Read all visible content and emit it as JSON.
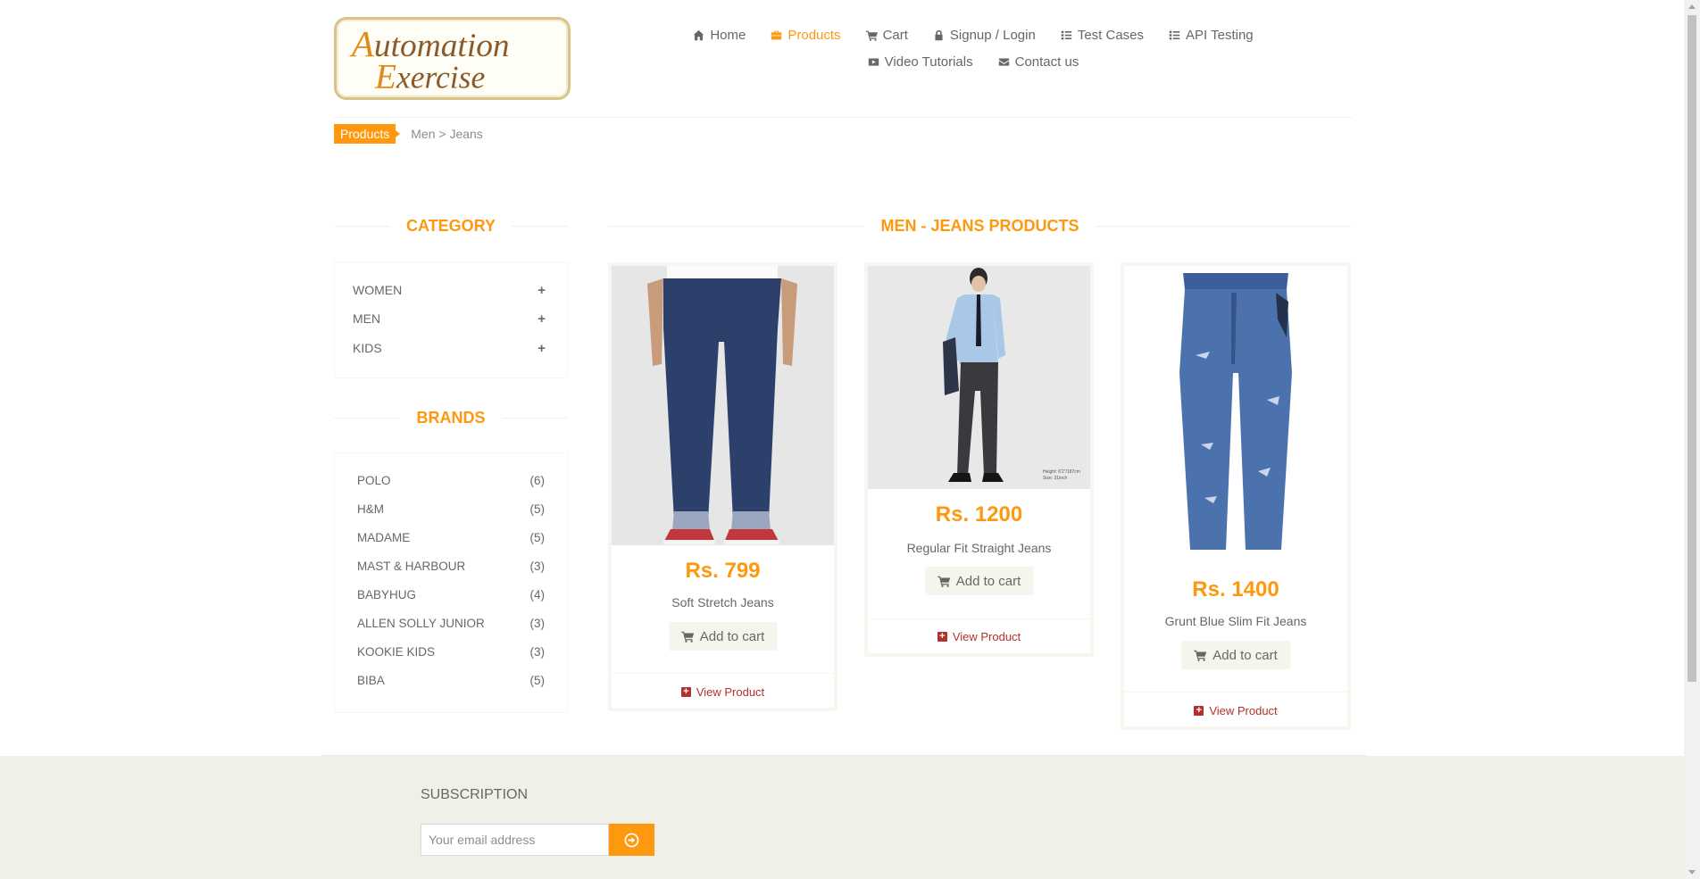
{
  "logo": {
    "line1": "Automation",
    "line2": "Exercise"
  },
  "nav": {
    "row1": [
      {
        "label": "Home",
        "icon": "home-icon"
      },
      {
        "label": "Products",
        "icon": "briefcase-icon",
        "active": true
      },
      {
        "label": "Cart",
        "icon": "cart-icon"
      },
      {
        "label": "Signup / Login",
        "icon": "lock-icon"
      },
      {
        "label": "Test Cases",
        "icon": "list-icon"
      },
      {
        "label": "API Testing",
        "icon": "list-icon"
      }
    ],
    "row2": [
      {
        "label": "Video Tutorials",
        "icon": "youtube-icon"
      },
      {
        "label": "Contact us",
        "icon": "envelope-icon"
      }
    ]
  },
  "breadcrumb": {
    "active": "Products",
    "rest": "Men > Jeans"
  },
  "sidebar": {
    "category_title": "Category",
    "categories": [
      "WOMEN",
      "MEN",
      "KIDS"
    ],
    "brands_title": "Brands",
    "brands": [
      {
        "name": "POLO",
        "count": "(6)"
      },
      {
        "name": "H&M",
        "count": "(5)"
      },
      {
        "name": "MADAME",
        "count": "(5)"
      },
      {
        "name": "MAST & HARBOUR",
        "count": "(3)"
      },
      {
        "name": "BABYHUG",
        "count": "(4)"
      },
      {
        "name": "ALLEN SOLLY JUNIOR",
        "count": "(3)"
      },
      {
        "name": "KOOKIE KIDS",
        "count": "(3)"
      },
      {
        "name": "BIBA",
        "count": "(5)"
      }
    ]
  },
  "main": {
    "title": "Men - Jeans Products",
    "products": [
      {
        "price": "Rs. 799",
        "name": "Soft Stretch Jeans",
        "cart_label": "Add to cart",
        "view_label": "View Product"
      },
      {
        "price": "Rs. 1200",
        "name": "Regular Fit Straight Jeans",
        "cart_label": "Add to cart",
        "view_label": "View Product",
        "photo_note": "Height: 6'2\"/187cm\nSize: 31inch"
      },
      {
        "price": "Rs. 1400",
        "name": "Grunt Blue Slim Fit Jeans",
        "cart_label": "Add to cart",
        "view_label": "View Product"
      }
    ]
  },
  "footer": {
    "subscription_title": "Subscription",
    "email_placeholder": "Your email address"
  },
  "colors": {
    "accent": "#fe980f",
    "text": "#696763",
    "view_link": "#b3302c",
    "footer_bg": "#f0f0e9"
  }
}
